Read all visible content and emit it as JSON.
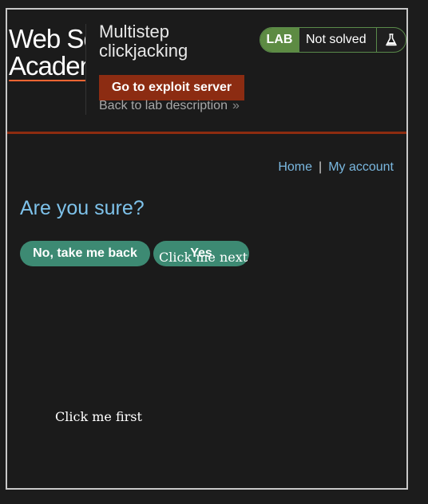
{
  "header": {
    "logo_lines": [
      "Web Security",
      "Academy"
    ],
    "lab_title": "Multistep clickjacking",
    "exploit_button": "Go to exploit server",
    "back_link": "Back to lab description",
    "back_chevron": "»",
    "status": {
      "badge": "LAB",
      "text": "Not solved",
      "icon": "flask-icon"
    }
  },
  "nav": {
    "home": "Home",
    "separator": "|",
    "account": "My account"
  },
  "main": {
    "question": "Are you sure?",
    "no_button": "No, take me back",
    "yes_button": "Yes"
  },
  "decoy": {
    "first": "Click me first",
    "next": "Click me next"
  },
  "colors": {
    "accent_orange": "#8c2c12",
    "lab_green": "#5d8b43",
    "button_teal": "#3d8a73",
    "link_blue": "#7ab8e0"
  }
}
